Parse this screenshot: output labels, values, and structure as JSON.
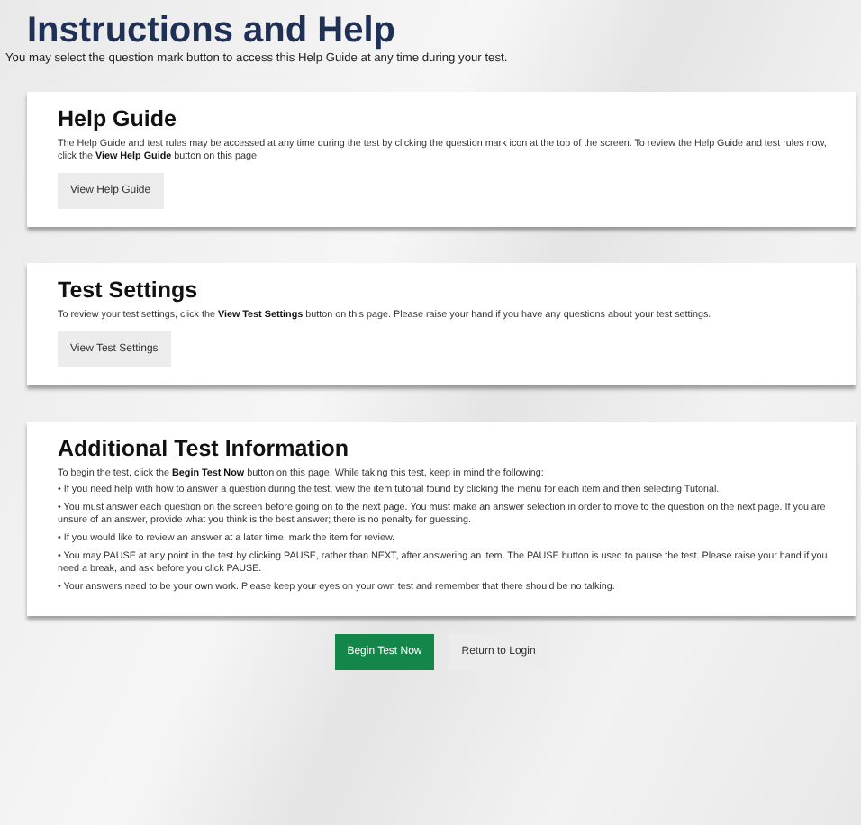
{
  "title": "Instructions and Help",
  "subtitle": "You may select the question mark button to access this Help Guide at any time during your test.",
  "sections": [
    {
      "heading": "Help Guide",
      "paragraphs": [
        "The Help Guide and test rules may be accessed at any time during the test by clicking the question mark icon at the top of the screen. To review the Help Guide and test rules now, click the **View Help Guide** button on this page."
      ],
      "button": "View Help Guide"
    },
    {
      "heading": "Test Settings",
      "paragraphs": [
        "To review your test settings, click the **View Test Settings** button on this page. Please raise your hand if you have any questions about your test settings."
      ],
      "button": "View Test Settings"
    },
    {
      "heading": "Additional Test Information",
      "paragraphs": [
        "To begin the test, click the **Begin Test Now** button on this page. While taking this test, keep in mind the following:",
        "•  If you need help with how to answer a question during the test, view the item tutorial found by clicking the menu for each item and then selecting Tutorial.",
        "•  You must answer each question on the screen before going on to the next page. You must make an answer selection in order to move to the question on the next page. If you are unsure of an answer, provide what you think is the best answer; there is no penalty for guessing.",
        "•  If you would like to review an answer at a later time, mark the item for review.",
        "•  You may PAUSE at any point in the test by clicking PAUSE, rather than NEXT, after answering an item. The PAUSE button is used to pause the test. Please raise your hand if you need a break, and ask before you click PAUSE.",
        "•  Your answers need to be your own work. Please keep your eyes on your own test and remember that there should be no talking."
      ]
    }
  ],
  "actions": [
    {
      "label": "Begin Test Now",
      "kind": "primary"
    },
    {
      "label": "Return to Login",
      "kind": "secondary"
    }
  ]
}
